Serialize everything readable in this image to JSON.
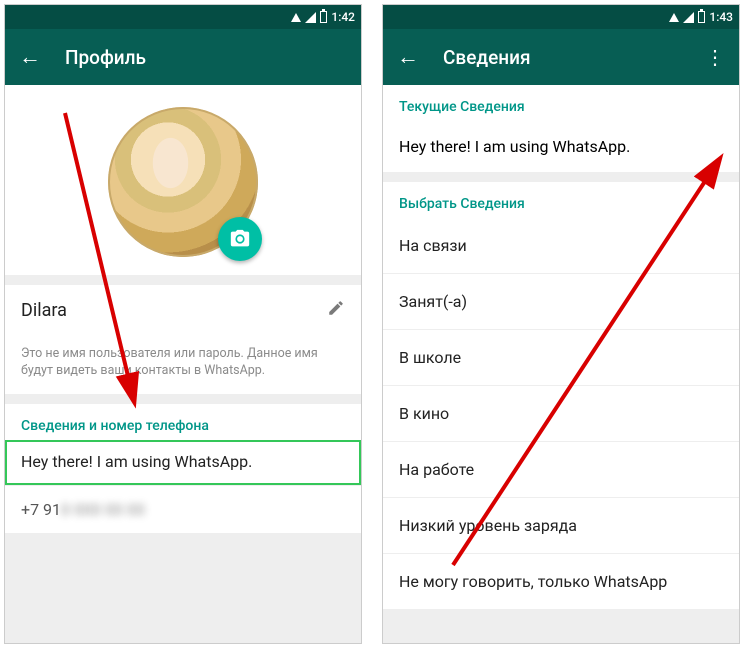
{
  "phone1": {
    "statusbar_time": "1:42",
    "appbar_title": "Профиль",
    "username": "Dilara",
    "hint_text": "Это не имя пользователя или пароль. Данное имя будут видеть ваши контакты в WhatsApp.",
    "section_title": "Сведения и номер телефона",
    "status_text": "Hey there! I am using WhatsApp.",
    "phone_prefix": "+7 91",
    "phone_blur": "0 000 00 00"
  },
  "phone2": {
    "statusbar_time": "1:43",
    "appbar_title": "Сведения",
    "current_section_title": "Текущие Сведения",
    "current_status": "Hey there! I am using WhatsApp.",
    "select_section_title": "Выбрать Сведения",
    "options": [
      "На связи",
      "Занят(-а)",
      "В школе",
      "В кино",
      "На работе",
      "Низкий уровень заряда",
      "Не могу говорить, только WhatsApp"
    ]
  }
}
